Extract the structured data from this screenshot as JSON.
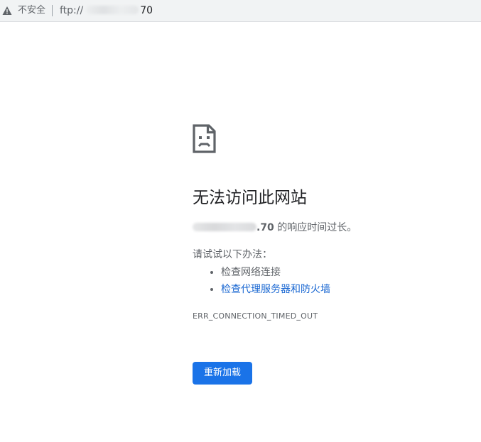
{
  "address_bar": {
    "security_icon": "warning-triangle-icon",
    "security_label": "不安全",
    "url_prefix": "ftp://",
    "url_suffix": "70"
  },
  "error_page": {
    "icon": "sad-page-icon",
    "title": "无法访问此网站",
    "host_suffix": ".70",
    "timed_out_text": "的响应时间过长。",
    "suggestions_label": "请试试以下办法：",
    "suggestions": [
      {
        "label": "检查网络连接",
        "is_link": false
      },
      {
        "label": "检查代理服务器和防火墙",
        "is_link": true
      }
    ],
    "error_code": "ERR_CONNECTION_TIMED_OUT",
    "reload_label": "重新加载"
  },
  "colors": {
    "link": "#1967d2",
    "button": "#1a73e8",
    "text_primary": "#202124",
    "text_secondary": "#5f6368"
  }
}
